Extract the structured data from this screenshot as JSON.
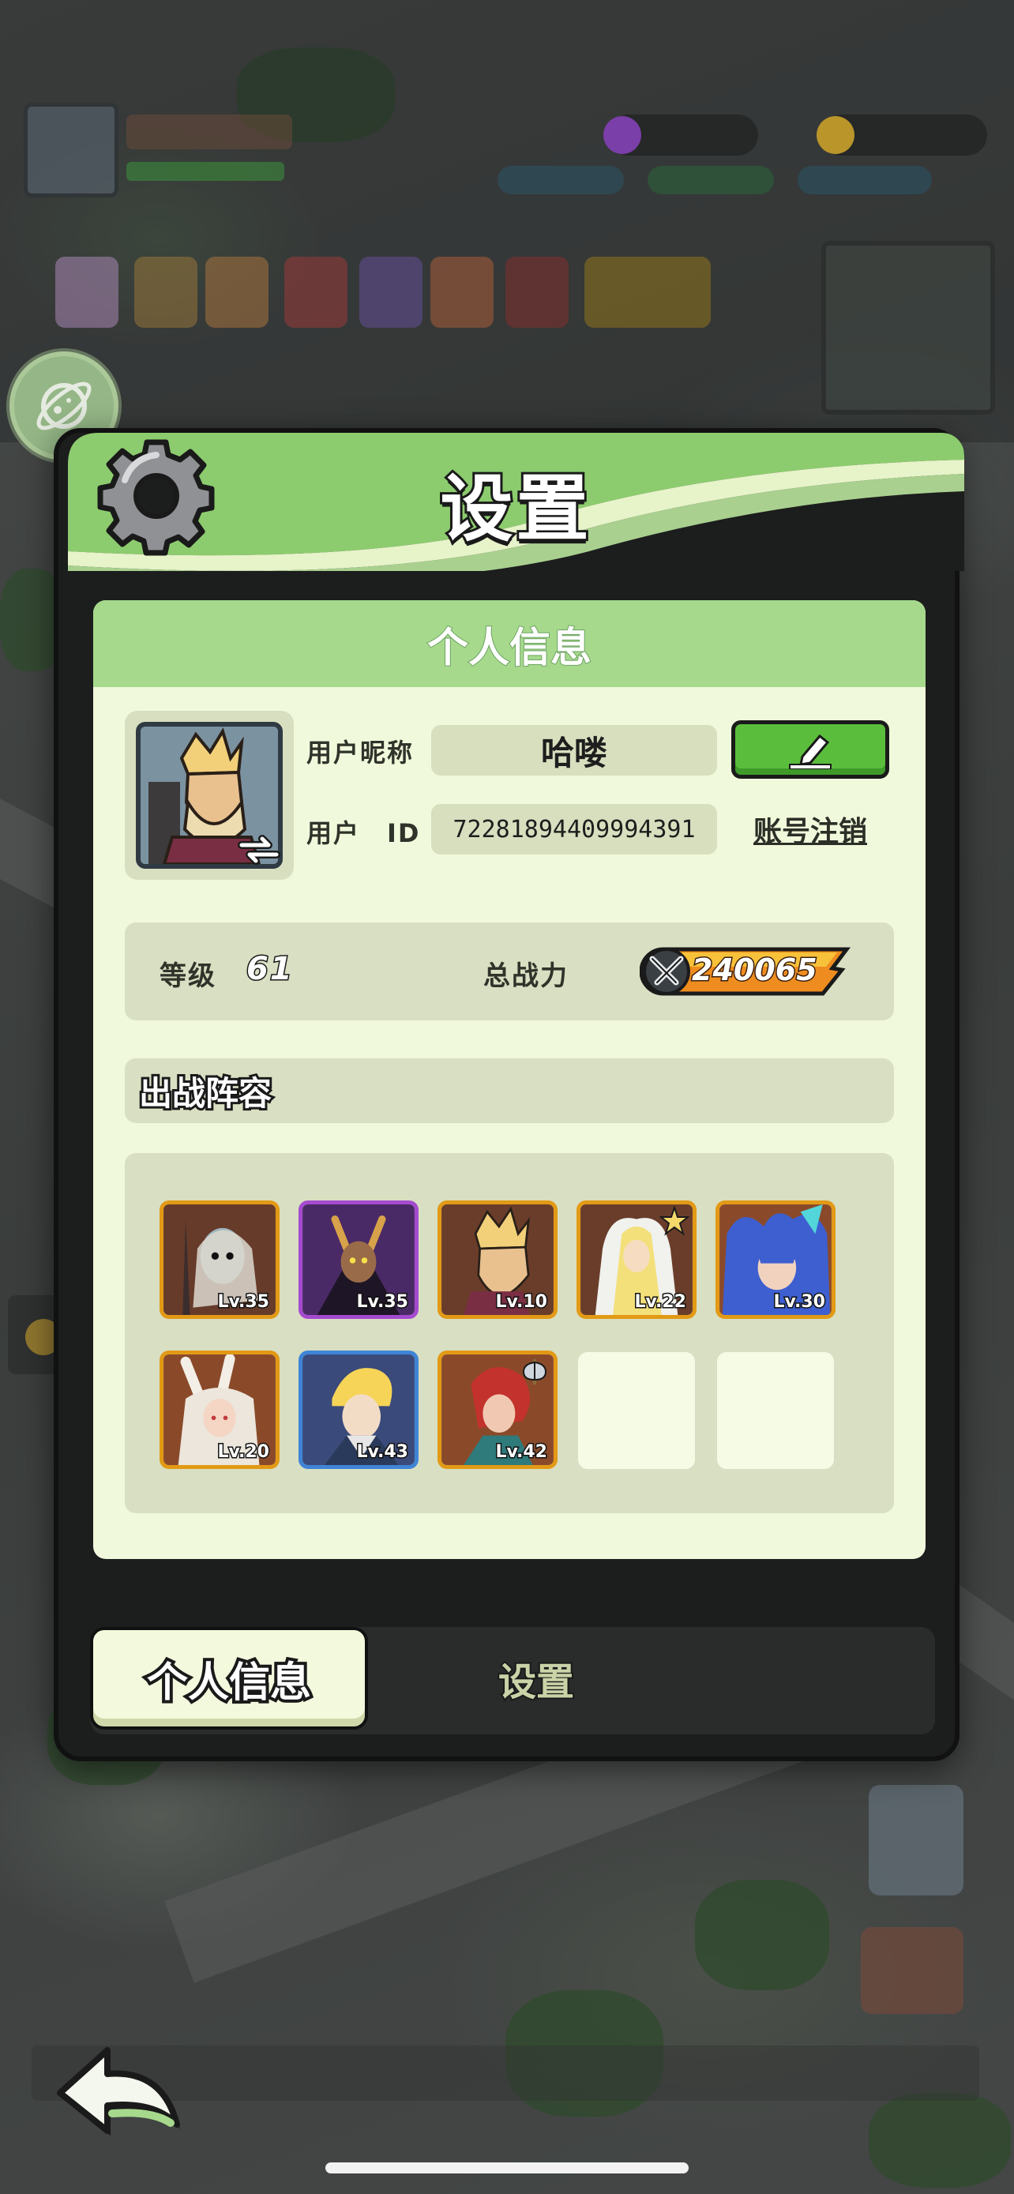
{
  "modal": {
    "title": "设置",
    "panel_title": "个人信息"
  },
  "profile": {
    "nickname_label": "用户昵称",
    "nickname": "哈喽",
    "id_label": "用户　ID",
    "user_id": "72281894409994391",
    "cancel_account": "账号注销"
  },
  "stats": {
    "level_label": "等级",
    "level": "61",
    "power_label": "总战力",
    "power": "240065"
  },
  "lineup": {
    "title": "出战阵容",
    "heroes": [
      {
        "level": "Lv.35",
        "rarity": "orange"
      },
      {
        "level": "Lv.35",
        "rarity": "purple"
      },
      {
        "level": "Lv.10",
        "rarity": "orange"
      },
      {
        "level": "Lv.22",
        "rarity": "orange"
      },
      {
        "level": "Lv.30",
        "rarity": "orange"
      },
      {
        "level": "Lv.20",
        "rarity": "orange"
      },
      {
        "level": "Lv.43",
        "rarity": "blue"
      },
      {
        "level": "Lv.42",
        "rarity": "orange"
      }
    ],
    "empty_slots": 2
  },
  "tabs": [
    {
      "label": "个人信息",
      "active": true
    },
    {
      "label": "设置",
      "active": false
    }
  ],
  "colors": {
    "panel_green": "#a6d98c",
    "panel_bg": "#f1f9dc",
    "edit_button": "#5bbd3c",
    "rarity_orange": "#e29a16",
    "rarity_purple": "#a44bcf",
    "rarity_blue": "#3f84d6"
  },
  "icons": {
    "settings": "gear-icon",
    "edit": "pencil-icon",
    "power": "crossed-swords-icon",
    "back": "back-arrow-icon",
    "switch_avatar": "swap-arrow-icon"
  }
}
